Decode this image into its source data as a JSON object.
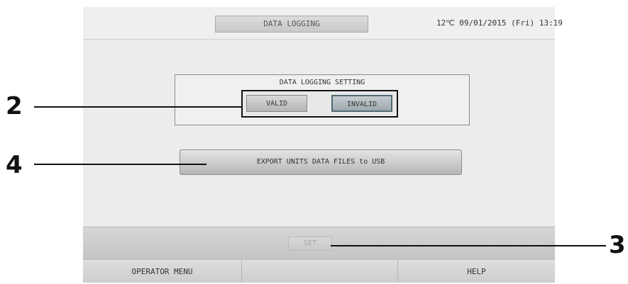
{
  "header": {
    "title": "DATA LOGGING",
    "temperature": "12℃",
    "datetime": "09/01/2015 (Fri) 13:19"
  },
  "setting": {
    "title": "DATA LOGGING SETTING",
    "options": [
      "VALID",
      "INVALID"
    ],
    "selected": "INVALID"
  },
  "export_button": "EXPORT UNITS DATA FILES to USB",
  "set_button": "SET",
  "footer": {
    "left": "OPERATOR MENU",
    "middle": "",
    "right": "HELP"
  },
  "callouts": [
    "2",
    "4",
    "3"
  ]
}
